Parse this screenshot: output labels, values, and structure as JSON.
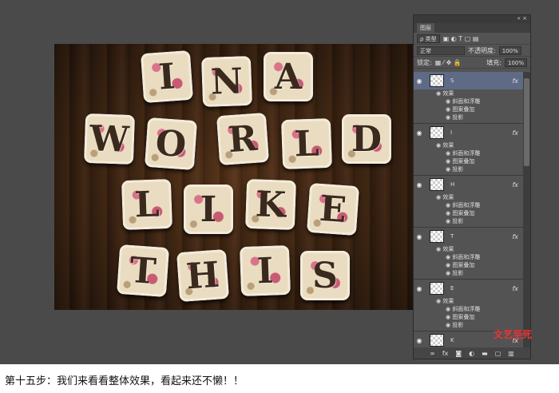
{
  "canvas": {
    "rows": [
      [
        "I",
        "N",
        "A"
      ],
      [
        "W",
        "O",
        "R",
        "L",
        "D"
      ],
      [
        "L",
        "I",
        "K",
        "E"
      ],
      [
        "T",
        "H",
        "I",
        "S"
      ]
    ]
  },
  "panel": {
    "title": "图层",
    "filter": "ρ 类型",
    "blend": "正常",
    "opacity_label": "不透明度:",
    "opacity": "100%",
    "lock_label": "锁定:",
    "fill_label": "填充:",
    "fill": "100%",
    "layers": [
      {
        "name": "S",
        "selected": true
      },
      {
        "name": "I"
      },
      {
        "name": "H"
      },
      {
        "name": "T"
      },
      {
        "name": "E"
      },
      {
        "name": "K"
      }
    ],
    "effects_label": "效果",
    "effects": [
      "斜面和浮雕",
      "图案叠加",
      "投影"
    ],
    "fx": "fx"
  },
  "watermark": "文艺至死",
  "caption": "第十五步：我们来看看整体效果，看起来还不懒！！"
}
